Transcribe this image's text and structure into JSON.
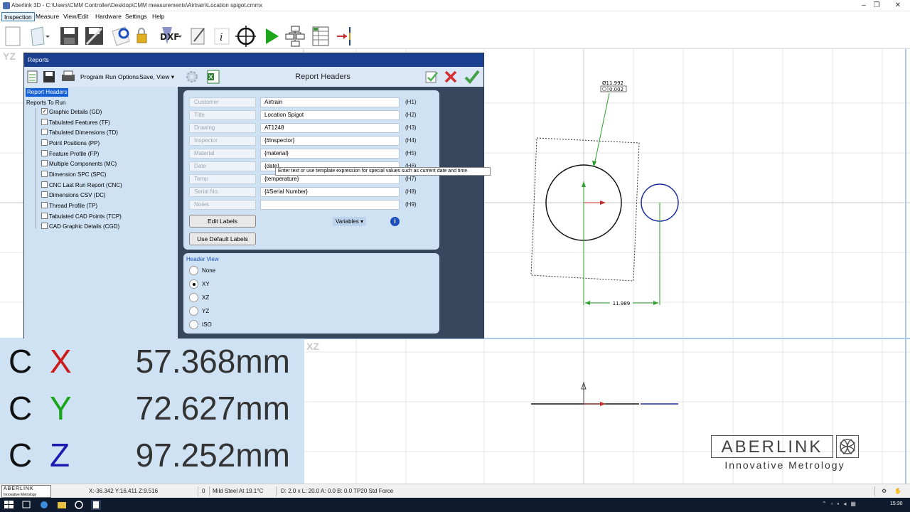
{
  "window": {
    "title": "Aberlink 3D - C:\\Users\\CMM Controller\\Desktop\\CMM measurements\\Airtrain\\Location spigot.cmmx"
  },
  "menu": {
    "items": [
      "Inspection",
      "Measure",
      "View/Edit",
      "Hardware",
      "Settings",
      "Help"
    ]
  },
  "toolbar": {
    "icons": [
      "new-file-icon",
      "open-file-icon",
      "save-icon",
      "save-as-icon",
      "disk-icon",
      "lock-icon",
      "dxf-icon",
      "edit-icon",
      "info-icon",
      "crosshair-icon",
      "run-icon",
      "hierarchy-icon",
      "grid-report-icon",
      "probe-icon"
    ],
    "dxf_label": "DXF",
    "info_label": "i"
  },
  "views": {
    "yz_label": "YZ",
    "xz_label": "XZ"
  },
  "drawing": {
    "diameter_label": "Ø11.992",
    "tolerance_label": "0.002",
    "dimension_label": "11.989"
  },
  "readout": {
    "prefix": "C",
    "x_axis": "X",
    "x_value": "57.368mm",
    "y_axis": "Y",
    "y_value": "72.627mm",
    "z_axis": "Z",
    "z_value": "97.252mm",
    "colors": {
      "x": "#cc1a1a",
      "y": "#1aa51a",
      "z": "#1a1ab3"
    }
  },
  "logo": {
    "name": "ABERLINK",
    "tagline": "Innovative Metrology",
    "small_name": "ABERLINK",
    "small_tagline": "Innovative Metrology"
  },
  "status": {
    "position": "X:-36.342 Y:16.411 Z:9.516",
    "count": "0",
    "material": "Mild Steel At 19.1°C",
    "probe": "D: 2.0 x L: 20.0 A: 0.0 B: 0.0 TP20 Std Force"
  },
  "taskbar": {
    "clock": "15:30"
  },
  "dialog": {
    "title": "Reports",
    "program_run_options": "Program Run Options",
    "save_view": "Save, View",
    "heading": "Report Headers",
    "tree": {
      "selected": "Report Headers",
      "group": "Reports To Run",
      "items": [
        {
          "label": "Graphic Details (GD)",
          "checked": true
        },
        {
          "label": "Tabulated Features (TF)",
          "checked": false
        },
        {
          "label": "Tabulated Dimensions (TD)",
          "checked": false
        },
        {
          "label": "Point Positions (PP)",
          "checked": false
        },
        {
          "label": "Feature Profile (FP)",
          "checked": false
        },
        {
          "label": "Multiple Components (MC)",
          "checked": false
        },
        {
          "label": "Dimension SPC (SPC)",
          "checked": false
        },
        {
          "label": "CNC Last Run Report (CNC)",
          "checked": false
        },
        {
          "label": "Dimensions CSV (DC)",
          "checked": false
        },
        {
          "label": "Thread Profile (TP)",
          "checked": false
        },
        {
          "label": "Tabulated CAD Points (TCP)",
          "checked": false
        },
        {
          "label": "CAD Graphic Details (CGD)",
          "checked": false
        }
      ]
    },
    "headers": [
      {
        "label": "Customer",
        "value": "Airtrain",
        "code": "(H1)"
      },
      {
        "label": "Title",
        "value": "Location Spigot",
        "code": "(H2)"
      },
      {
        "label": "Drawing",
        "value": "AT1248",
        "code": "(H3)"
      },
      {
        "label": "Inspector",
        "value": "{#inspector}",
        "code": "(H4)"
      },
      {
        "label": "Material",
        "value": "{material}",
        "code": "(H5)"
      },
      {
        "label": "Date",
        "value": "{date}",
        "code": "(H6)"
      },
      {
        "label": "Temp",
        "value": "{temperature}",
        "code": "(H7)"
      },
      {
        "label": "Serial No.",
        "value": "{#Serial Number}",
        "code": "(H8)"
      },
      {
        "label": "Notes",
        "value": "",
        "code": "(H9)"
      }
    ],
    "edit_labels": "Edit Labels",
    "use_default_labels": "Use Default Labels",
    "variables": "Variables",
    "tooltip": "Enter text or use template expression for special values such as current date and time",
    "header_view": {
      "title": "Header View",
      "options": [
        "None",
        "XY",
        "XZ",
        "YZ",
        "ISO"
      ],
      "selected": "XY"
    }
  }
}
